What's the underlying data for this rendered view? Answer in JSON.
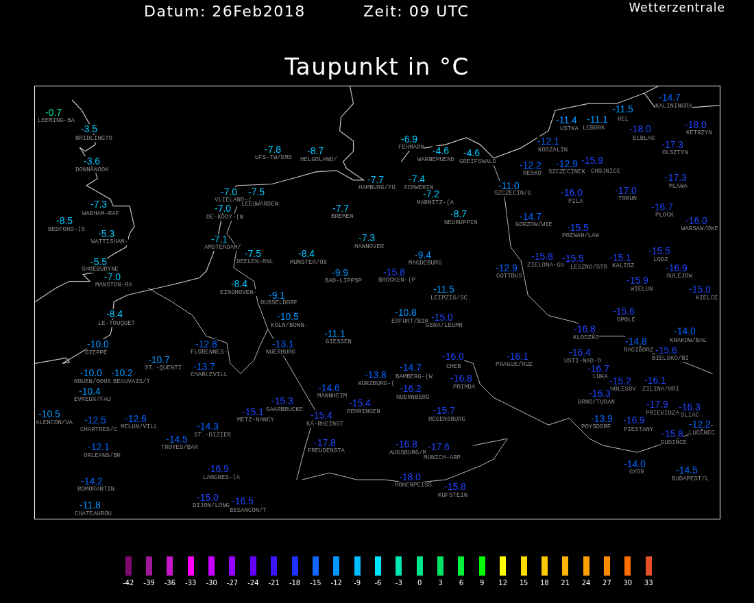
{
  "header": {
    "date": "Datum: 26Feb2018",
    "time": "Zeit: 09 UTC",
    "source": "Wetterzentrale"
  },
  "title": "Taupunkt in °C",
  "stations": [
    {
      "value": "-14.7",
      "name": "KALININGRA",
      "color": "#0064ff"
    },
    {
      "value": "-0.7",
      "name": "LEEMING-BA",
      "color": "#00e68c"
    },
    {
      "value": "-11.5",
      "name": "HEL",
      "color": "#0096ff"
    },
    {
      "value": "-11.4",
      "name": "USTKA",
      "color": "#0096ff"
    },
    {
      "value": "-11.1",
      "name": "LEBORK",
      "color": "#0096ff"
    },
    {
      "value": "-3.5",
      "name": "BRIDLINGTO",
      "color": "#00c8ff"
    },
    {
      "value": "-18.0",
      "name": "ELBLAG",
      "color": "#1e46ff"
    },
    {
      "value": "-18.0",
      "name": "KETRZYN",
      "color": "#1e46ff"
    },
    {
      "value": "-7.8",
      "name": "UFS-TW/EMS",
      "color": "#00c8ff"
    },
    {
      "value": "-8.7",
      "name": "HELGOLAND/",
      "color": "#00c8ff"
    },
    {
      "value": "-6.9",
      "name": "FEHMARN",
      "color": "#00c8ff"
    },
    {
      "value": "-4.6",
      "name": "WARNEMUEND",
      "color": "#00c8ff"
    },
    {
      "value": "-4.6",
      "name": "GREIFSWALD",
      "color": "#00c8ff"
    },
    {
      "value": "-12.1",
      "name": "KOSZALIN",
      "color": "#0064ff"
    },
    {
      "value": "-17.3",
      "name": "OLSZTYN",
      "color": "#1e46ff"
    },
    {
      "value": "-3.6",
      "name": "DONNANOOK",
      "color": "#00c8ff"
    },
    {
      "value": "-12.2",
      "name": "RESKO",
      "color": "#0064ff"
    },
    {
      "value": "-12.9",
      "name": "SZCZECINEK",
      "color": "#0064ff"
    },
    {
      "value": "-15.9",
      "name": "CHOJNICE",
      "color": "#1e46ff"
    },
    {
      "value": "-7.0",
      "name": "VLIELAND-/",
      "color": "#00c8ff"
    },
    {
      "value": "-7.5",
      "name": "LEEUWARDEN",
      "color": "#00c8ff"
    },
    {
      "value": "-7.7",
      "name": "HAMBURG/FU",
      "color": "#00c8ff"
    },
    {
      "value": "-7.4",
      "name": "SCHWERIN",
      "color": "#00c8ff"
    },
    {
      "value": "-7.2",
      "name": "MARNITZ-(A",
      "color": "#00c8ff"
    },
    {
      "value": "-11.0",
      "name": "SZCZECIN/G",
      "color": "#0096ff"
    },
    {
      "value": "-16.0",
      "name": "PILA",
      "color": "#1e46ff"
    },
    {
      "value": "-17.0",
      "name": "TORUN",
      "color": "#1e46ff"
    },
    {
      "value": "-17.3",
      "name": "MLAWA",
      "color": "#1e46ff"
    },
    {
      "value": "-7.3",
      "name": "WARHAM-RAF",
      "color": "#00c8ff"
    },
    {
      "value": "-7.0",
      "name": "DE-KOOY-(N",
      "color": "#00c8ff"
    },
    {
      "value": "-7.7",
      "name": "BREMEN",
      "color": "#00c8ff"
    },
    {
      "value": "-16.7",
      "name": "PLOCK",
      "color": "#1e46ff"
    },
    {
      "value": "-8.5",
      "name": "BEDFORD-(S",
      "color": "#00c8ff"
    },
    {
      "value": "-8.7",
      "name": "NEURUPPIN",
      "color": "#00c8ff"
    },
    {
      "value": "-14.7",
      "name": "GORZOW/WIE",
      "color": "#0064ff"
    },
    {
      "value": "-16.0",
      "name": "WARSAW/OKE",
      "color": "#1e46ff"
    },
    {
      "value": "-5.3",
      "name": "WATTISHAM-",
      "color": "#00c8ff"
    },
    {
      "value": "-7.1",
      "name": "AMSTERDAM/",
      "color": "#00c8ff"
    },
    {
      "value": "-7.3",
      "name": "HANNOVER",
      "color": "#00c8ff"
    },
    {
      "value": "-15.5",
      "name": "POZNAN/LAW",
      "color": "#1e46ff"
    },
    {
      "value": "-7.5",
      "name": "DEELEN-RNL",
      "color": "#00c8ff"
    },
    {
      "value": "-8.4",
      "name": "MUNSTER/OS",
      "color": "#00c8ff"
    },
    {
      "value": "-9.4",
      "name": "MAGDEBURG",
      "color": "#0096ff"
    },
    {
      "value": "-15.8",
      "name": "ZIELONA-GO",
      "color": "#1e46ff"
    },
    {
      "value": "-15.5",
      "name": "LESZNO/STR",
      "color": "#1e46ff"
    },
    {
      "value": "-15.1",
      "name": "KALISZ",
      "color": "#1e46ff"
    },
    {
      "value": "-15.5",
      "name": "LODZ",
      "color": "#1e46ff"
    },
    {
      "value": "-5.5",
      "name": "SHOEBURYNE",
      "color": "#00c8ff"
    },
    {
      "value": "-9.9",
      "name": "BAD-LIPPSP",
      "color": "#0096ff"
    },
    {
      "value": "-15.8",
      "name": "BROCKEN-(P",
      "color": "#1e46ff"
    },
    {
      "value": "-12.9",
      "name": "COTTBUS",
      "color": "#0064ff"
    },
    {
      "value": "-16.9",
      "name": "SULEJOW",
      "color": "#1e46ff"
    },
    {
      "value": "-7.0",
      "name": "MANSTON-RA",
      "color": "#00c8ff"
    },
    {
      "value": "-8.4",
      "name": "EINDHOVEN-",
      "color": "#00c8ff"
    },
    {
      "value": "-15.9",
      "name": "WIELUN",
      "color": "#1e46ff"
    },
    {
      "value": "-9.1",
      "name": "DUSSELDORF",
      "color": "#0096ff"
    },
    {
      "value": "-11.5",
      "name": "LEIPZIG/SC",
      "color": "#0096ff"
    },
    {
      "value": "-15.0",
      "name": "KIELCE",
      "color": "#1e46ff"
    },
    {
      "value": "-8.4",
      "name": "LE-TOUQUET",
      "color": "#00c8ff"
    },
    {
      "value": "-10.5",
      "name": "KOLN/BONN-",
      "color": "#0096ff"
    },
    {
      "value": "-10.8",
      "name": "ERFURT/BIN",
      "color": "#0096ff"
    },
    {
      "value": "-15.0",
      "name": "GERA/LEUMN",
      "color": "#1e46ff"
    },
    {
      "value": "-15.6",
      "name": "OPOLE",
      "color": "#1e46ff"
    },
    {
      "value": "-11.1",
      "name": "GIESSEN",
      "color": "#0096ff"
    },
    {
      "value": "-16.8",
      "name": "KLODZKO",
      "color": "#1e46ff"
    },
    {
      "value": "-14.0",
      "name": "KRAKOW/BAL",
      "color": "#0064ff"
    },
    {
      "value": "-10.0",
      "name": "DIEPPE",
      "color": "#0096ff"
    },
    {
      "value": "-12.8",
      "name": "FLORENNES-",
      "color": "#0064ff"
    },
    {
      "value": "-13.1",
      "name": "NUERBURG",
      "color": "#0064ff"
    },
    {
      "value": "-14.8",
      "name": "RACIBORZ",
      "color": "#0064ff"
    },
    {
      "value": "-16.0",
      "name": "CHEB",
      "color": "#1e46ff"
    },
    {
      "value": "-16.1",
      "name": "PRAGUE/RUZ",
      "color": "#1e46ff"
    },
    {
      "value": "-16.4",
      "name": "USTI-NAD-O",
      "color": "#1e46ff"
    },
    {
      "value": "-15.6",
      "name": "BIELSKO/BI",
      "color": "#1e46ff"
    },
    {
      "value": "-10.7",
      "name": "ST.-QUENTI",
      "color": "#0096ff"
    },
    {
      "value": "-13.7",
      "name": "CHARLEVILL",
      "color": "#0064ff"
    },
    {
      "value": "-14.7",
      "name": "BAMBERG-(W",
      "color": "#0064ff"
    },
    {
      "value": "-16.7",
      "name": "LUKA",
      "color": "#1e46ff"
    },
    {
      "value": "-10.0",
      "name": "ROUEN/BOOS",
      "color": "#0096ff"
    },
    {
      "value": "-10.2",
      "name": "BEAUVAIS/T",
      "color": "#0096ff"
    },
    {
      "value": "-13.8",
      "name": "WURZBURG-(",
      "color": "#0064ff"
    },
    {
      "value": "-16.8",
      "name": "PRIMDA",
      "color": "#1e46ff"
    },
    {
      "value": "-15.2",
      "name": "HOLESOV",
      "color": "#1e46ff"
    },
    {
      "value": "-16.1",
      "name": "ZILINA/HRI",
      "color": "#1e46ff"
    },
    {
      "value": "-10.4",
      "name": "EVREUX/FAU",
      "color": "#0096ff"
    },
    {
      "value": "-14.6",
      "name": "MANNHEIM",
      "color": "#0064ff"
    },
    {
      "value": "-16.2",
      "name": "NUERNBERG",
      "color": "#1e46ff"
    },
    {
      "value": "-16.3",
      "name": "BRNO/TURAN",
      "color": "#1e46ff"
    },
    {
      "value": "-15.1",
      "name": "METZ-NANCY",
      "color": "#1e46ff"
    },
    {
      "value": "-15.3",
      "name": "SAARBRUCKE",
      "color": "#1e46ff"
    },
    {
      "value": "-15.4",
      "name": "OEHRINGEN",
      "color": "#1e46ff"
    },
    {
      "value": "-15.7",
      "name": "REGENSBURG",
      "color": "#1e46ff"
    },
    {
      "value": "-17.9",
      "name": "PRIEVIDZA",
      "color": "#1e46ff"
    },
    {
      "value": "-16.3",
      "name": "SLIAC",
      "color": "#1e46ff"
    },
    {
      "value": "-10.5",
      "name": "ALENCON/VA",
      "color": "#0096ff"
    },
    {
      "value": "-12.5",
      "name": "CHARTRES/C",
      "color": "#0064ff"
    },
    {
      "value": "-12.6",
      "name": "MELUN/VILL",
      "color": "#0064ff"
    },
    {
      "value": "-14.3",
      "name": "ST.-DIZIER",
      "color": "#0064ff"
    },
    {
      "value": "-15.4",
      "name": "KA-RHEINST",
      "color": "#1e46ff"
    },
    {
      "value": "-13.9",
      "name": "POYSDORF",
      "color": "#0064ff"
    },
    {
      "value": "-16.9",
      "name": "PIESTANY",
      "color": "#1e46ff"
    },
    {
      "value": "-15.8",
      "name": "DUDINCE",
      "color": "#1e46ff"
    },
    {
      "value": "-12.2",
      "name": "LUCENEC",
      "color": "#0064ff"
    },
    {
      "value": "-12.1",
      "name": "ORLEANS/BR",
      "color": "#0064ff"
    },
    {
      "value": "-14.5",
      "name": "TROYES/BAR",
      "color": "#0064ff"
    },
    {
      "value": "-17.8",
      "name": "FREUDENSTA",
      "color": "#1e46ff"
    },
    {
      "value": "-16.8",
      "name": "AUGSBURG/M",
      "color": "#1e46ff"
    },
    {
      "value": "-17.6",
      "name": "MUNICH-ARP",
      "color": "#1e46ff"
    },
    {
      "value": "-16.9",
      "name": "LANGRES-(A",
      "color": "#1e46ff"
    },
    {
      "value": "-14.0",
      "name": "GYOR",
      "color": "#0064ff"
    },
    {
      "value": "-14.5",
      "name": "BUDAPEST/L",
      "color": "#0064ff"
    },
    {
      "value": "-14.2",
      "name": "ROMORANTIN",
      "color": "#0064ff"
    },
    {
      "value": "-18.0",
      "name": "HOHENPEISS",
      "color": "#1e46ff"
    },
    {
      "value": "-15.8",
      "name": "KUFSTEIN",
      "color": "#1e46ff"
    },
    {
      "value": "-11.8",
      "name": "CHATEAUROU",
      "color": "#0096ff"
    },
    {
      "value": "-15.0",
      "name": "DIJON/LONG",
      "color": "#1e46ff"
    },
    {
      "value": "-16.5",
      "name": "BESANCON/T",
      "color": "#1e46ff"
    }
  ],
  "legend": [
    {
      "label": "-42",
      "color": "#7e0b6e"
    },
    {
      "label": "-39",
      "color": "#a0189a"
    },
    {
      "label": "-36",
      "color": "#c816c8"
    },
    {
      "label": "-33",
      "color": "#ff00ff"
    },
    {
      "label": "-30",
      "color": "#c800ff"
    },
    {
      "label": "-27",
      "color": "#9600ff"
    },
    {
      "label": "-24",
      "color": "#6400ff"
    },
    {
      "label": "-21",
      "color": "#3c14ff"
    },
    {
      "label": "-18",
      "color": "#1e32ff"
    },
    {
      "label": "-15",
      "color": "#1464ff"
    },
    {
      "label": "-12",
      "color": "#0096ff"
    },
    {
      "label": "-9",
      "color": "#00beff"
    },
    {
      "label": "-6",
      "color": "#00e6ff"
    },
    {
      "label": "-3",
      "color": "#00e6b4"
    },
    {
      "label": "0",
      "color": "#00e68c"
    },
    {
      "label": "3",
      "color": "#00e664"
    },
    {
      "label": "6",
      "color": "#00f03c"
    },
    {
      "label": "9",
      "color": "#00ff00"
    },
    {
      "label": "12",
      "color": "#ffff00"
    },
    {
      "label": "15",
      "color": "#ffdc00"
    },
    {
      "label": "18",
      "color": "#ffc800"
    },
    {
      "label": "21",
      "color": "#ffb400"
    },
    {
      "label": "24",
      "color": "#ffa000"
    },
    {
      "label": "27",
      "color": "#ff8c00"
    },
    {
      "label": "30",
      "color": "#ff6e00"
    },
    {
      "label": "33",
      "color": "#e65028"
    }
  ]
}
